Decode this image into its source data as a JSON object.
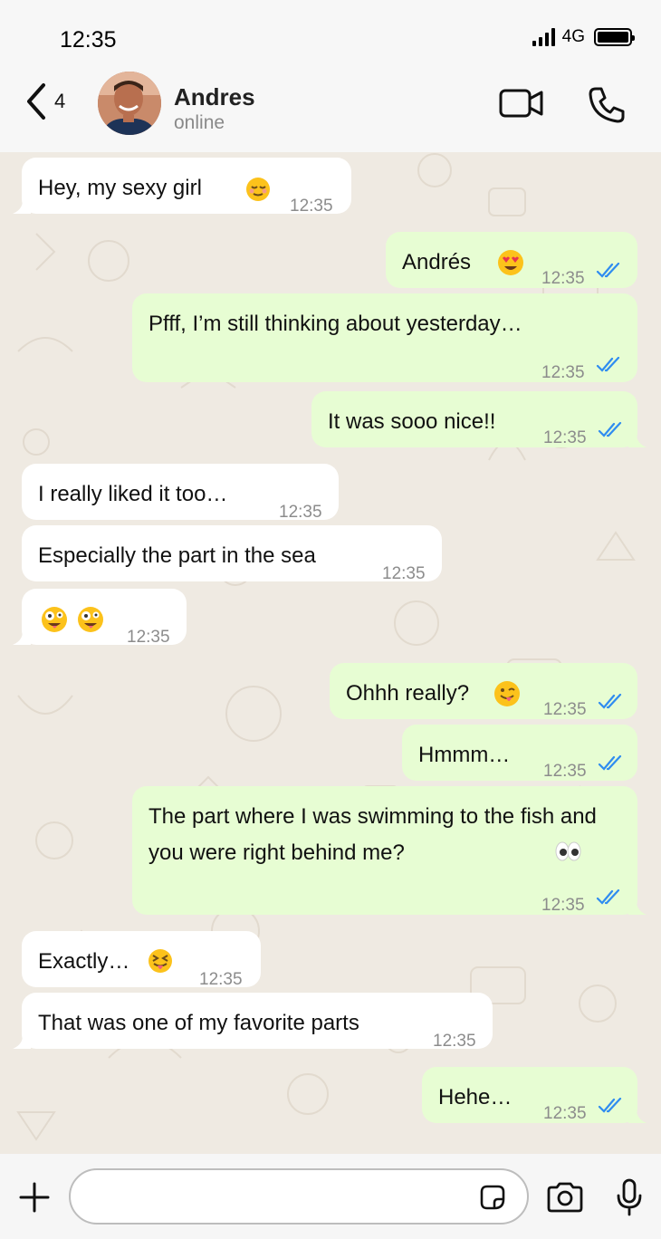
{
  "status_bar": {
    "time": "12:35",
    "network": "4G"
  },
  "header": {
    "back_count": "4",
    "contact_name": "Andres",
    "contact_status": "online"
  },
  "messages": [
    {
      "dir": "in",
      "text": "Hey, my sexy girl",
      "emoji": "relieved-face",
      "time": "12:35"
    },
    {
      "dir": "out",
      "text": "Andrés",
      "emoji": "heart-eyes-face",
      "time": "12:35",
      "read": true
    },
    {
      "dir": "out",
      "text": "Pfff, I’m still thinking about yesterday…",
      "time": "12:35",
      "read": true
    },
    {
      "dir": "out",
      "text": "It was sooo nice!!",
      "time": "12:35",
      "read": true
    },
    {
      "dir": "in",
      "text": "I really liked it too…",
      "time": "12:35"
    },
    {
      "dir": "in",
      "text": "Especially the part in the sea",
      "time": "12:35"
    },
    {
      "dir": "in",
      "text": "",
      "emoji": "zany-face zany-face",
      "time": "12:35"
    },
    {
      "dir": "out",
      "text": "Ohhh really?",
      "emoji": "winking-tongue-face",
      "time": "12:35",
      "read": true
    },
    {
      "dir": "out",
      "text": "Hmmm…",
      "time": "12:35",
      "read": true
    },
    {
      "dir": "out",
      "text": "The part where I was swimming to the fish and you were right behind me?",
      "emoji": "eyes",
      "time": "12:35",
      "read": true
    },
    {
      "dir": "in",
      "text": "Exactly…",
      "emoji": "squinting-tongue-face",
      "time": "12:35"
    },
    {
      "dir": "in",
      "text": "That was one of my favorite parts",
      "time": "12:35"
    },
    {
      "dir": "out",
      "text": "Hehe…",
      "time": "12:35",
      "read": true
    }
  ],
  "input": {
    "value": "",
    "placeholder": ""
  },
  "colors": {
    "incoming_bubble": "#ffffff",
    "outgoing_bubble": "#e7fdd3",
    "read_ticks": "#2f8cf0",
    "chat_background": "#efeae2"
  },
  "icons": [
    "chevron-left-icon",
    "video-camera-icon",
    "phone-icon",
    "plus-icon",
    "sticker-icon",
    "camera-icon",
    "microphone-icon",
    "double-check-icon"
  ]
}
